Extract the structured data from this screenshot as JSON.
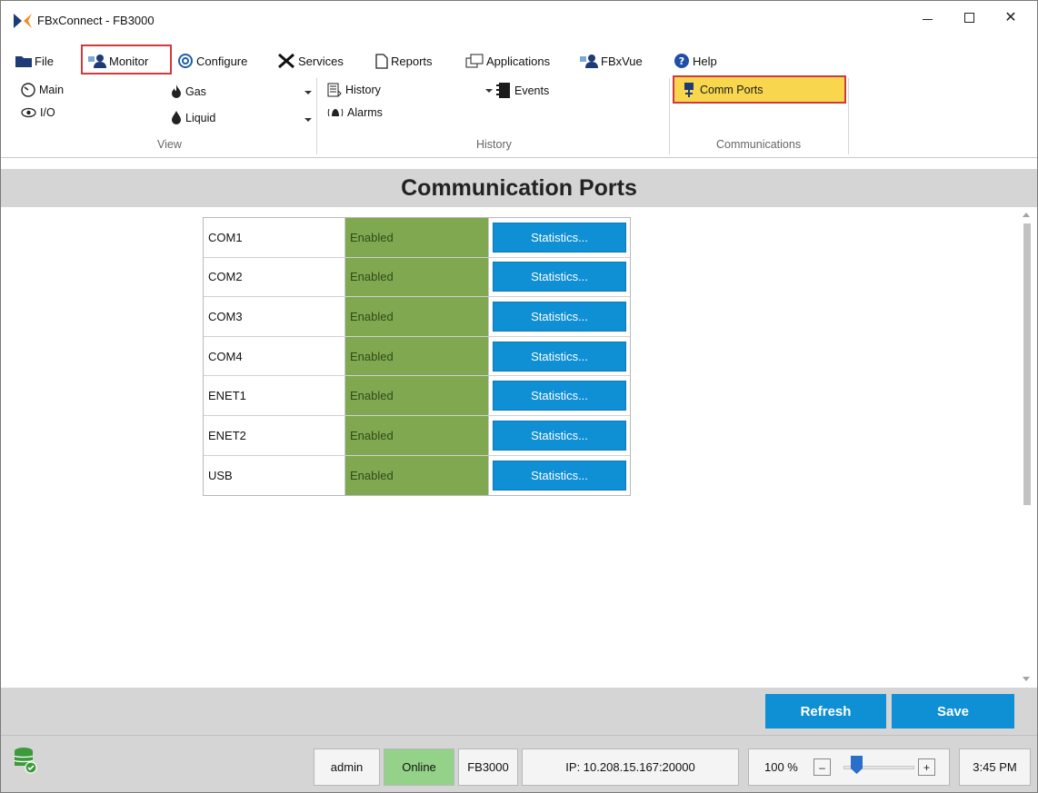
{
  "window": {
    "title": "FBxConnect - FB3000"
  },
  "menu": {
    "file": "File",
    "monitor": "Monitor",
    "configure": "Configure",
    "services": "Services",
    "reports": "Reports",
    "applications": "Applications",
    "fbxvue": "FBxVue",
    "help": "Help"
  },
  "ribbon": {
    "view": {
      "main": "Main",
      "io": "I/O",
      "gas": "Gas",
      "liquid": "Liquid",
      "label": "View"
    },
    "history": {
      "history": "History",
      "events": "Events",
      "alarms": "Alarms",
      "label": "History"
    },
    "communications": {
      "comm_ports": "Comm Ports",
      "label": "Communications"
    }
  },
  "page": {
    "title": "Communication Ports"
  },
  "ports": [
    {
      "name": "COM1",
      "status": "Enabled",
      "action": "Statistics..."
    },
    {
      "name": "COM2",
      "status": "Enabled",
      "action": "Statistics..."
    },
    {
      "name": "COM3",
      "status": "Enabled",
      "action": "Statistics..."
    },
    {
      "name": "COM4",
      "status": "Enabled",
      "action": "Statistics..."
    },
    {
      "name": "ENET1",
      "status": "Enabled",
      "action": "Statistics..."
    },
    {
      "name": "ENET2",
      "status": "Enabled",
      "action": "Statistics..."
    },
    {
      "name": "USB",
      "status": "Enabled",
      "action": "Statistics..."
    }
  ],
  "actions": {
    "refresh": "Refresh",
    "save": "Save"
  },
  "status_bar": {
    "user": "admin",
    "connection": "Online",
    "device": "FB3000",
    "ip": "IP: 10.208.15.167:20000",
    "zoom": "100 %",
    "zoom_minus": "–",
    "zoom_plus": "+",
    "time": "3:45 PM"
  },
  "colors": {
    "accent_blue": "#0f8fd4",
    "enabled_green": "#80a850",
    "online_green": "#94d28a",
    "highlight_yellow": "#f8d64e",
    "highlight_red": "#d23a3a"
  }
}
